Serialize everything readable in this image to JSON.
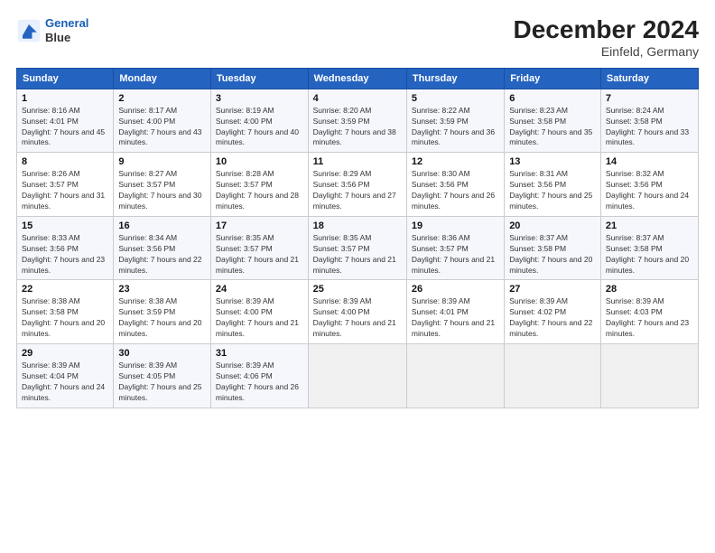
{
  "logo": {
    "line1": "General",
    "line2": "Blue"
  },
  "title": "December 2024",
  "subtitle": "Einfeld, Germany",
  "header_days": [
    "Sunday",
    "Monday",
    "Tuesday",
    "Wednesday",
    "Thursday",
    "Friday",
    "Saturday"
  ],
  "weeks": [
    [
      {
        "day": "1",
        "sunrise": "8:16 AM",
        "sunset": "4:01 PM",
        "daylight": "7 hours and 45 minutes."
      },
      {
        "day": "2",
        "sunrise": "8:17 AM",
        "sunset": "4:00 PM",
        "daylight": "7 hours and 43 minutes."
      },
      {
        "day": "3",
        "sunrise": "8:19 AM",
        "sunset": "4:00 PM",
        "daylight": "7 hours and 40 minutes."
      },
      {
        "day": "4",
        "sunrise": "8:20 AM",
        "sunset": "3:59 PM",
        "daylight": "7 hours and 38 minutes."
      },
      {
        "day": "5",
        "sunrise": "8:22 AM",
        "sunset": "3:59 PM",
        "daylight": "7 hours and 36 minutes."
      },
      {
        "day": "6",
        "sunrise": "8:23 AM",
        "sunset": "3:58 PM",
        "daylight": "7 hours and 35 minutes."
      },
      {
        "day": "7",
        "sunrise": "8:24 AM",
        "sunset": "3:58 PM",
        "daylight": "7 hours and 33 minutes."
      }
    ],
    [
      {
        "day": "8",
        "sunrise": "8:26 AM",
        "sunset": "3:57 PM",
        "daylight": "7 hours and 31 minutes."
      },
      {
        "day": "9",
        "sunrise": "8:27 AM",
        "sunset": "3:57 PM",
        "daylight": "7 hours and 30 minutes."
      },
      {
        "day": "10",
        "sunrise": "8:28 AM",
        "sunset": "3:57 PM",
        "daylight": "7 hours and 28 minutes."
      },
      {
        "day": "11",
        "sunrise": "8:29 AM",
        "sunset": "3:56 PM",
        "daylight": "7 hours and 27 minutes."
      },
      {
        "day": "12",
        "sunrise": "8:30 AM",
        "sunset": "3:56 PM",
        "daylight": "7 hours and 26 minutes."
      },
      {
        "day": "13",
        "sunrise": "8:31 AM",
        "sunset": "3:56 PM",
        "daylight": "7 hours and 25 minutes."
      },
      {
        "day": "14",
        "sunrise": "8:32 AM",
        "sunset": "3:56 PM",
        "daylight": "7 hours and 24 minutes."
      }
    ],
    [
      {
        "day": "15",
        "sunrise": "8:33 AM",
        "sunset": "3:56 PM",
        "daylight": "7 hours and 23 minutes."
      },
      {
        "day": "16",
        "sunrise": "8:34 AM",
        "sunset": "3:56 PM",
        "daylight": "7 hours and 22 minutes."
      },
      {
        "day": "17",
        "sunrise": "8:35 AM",
        "sunset": "3:57 PM",
        "daylight": "7 hours and 21 minutes."
      },
      {
        "day": "18",
        "sunrise": "8:35 AM",
        "sunset": "3:57 PM",
        "daylight": "7 hours and 21 minutes."
      },
      {
        "day": "19",
        "sunrise": "8:36 AM",
        "sunset": "3:57 PM",
        "daylight": "7 hours and 21 minutes."
      },
      {
        "day": "20",
        "sunrise": "8:37 AM",
        "sunset": "3:58 PM",
        "daylight": "7 hours and 20 minutes."
      },
      {
        "day": "21",
        "sunrise": "8:37 AM",
        "sunset": "3:58 PM",
        "daylight": "7 hours and 20 minutes."
      }
    ],
    [
      {
        "day": "22",
        "sunrise": "8:38 AM",
        "sunset": "3:58 PM",
        "daylight": "7 hours and 20 minutes."
      },
      {
        "day": "23",
        "sunrise": "8:38 AM",
        "sunset": "3:59 PM",
        "daylight": "7 hours and 20 minutes."
      },
      {
        "day": "24",
        "sunrise": "8:39 AM",
        "sunset": "4:00 PM",
        "daylight": "7 hours and 21 minutes."
      },
      {
        "day": "25",
        "sunrise": "8:39 AM",
        "sunset": "4:00 PM",
        "daylight": "7 hours and 21 minutes."
      },
      {
        "day": "26",
        "sunrise": "8:39 AM",
        "sunset": "4:01 PM",
        "daylight": "7 hours and 21 minutes."
      },
      {
        "day": "27",
        "sunrise": "8:39 AM",
        "sunset": "4:02 PM",
        "daylight": "7 hours and 22 minutes."
      },
      {
        "day": "28",
        "sunrise": "8:39 AM",
        "sunset": "4:03 PM",
        "daylight": "7 hours and 23 minutes."
      }
    ],
    [
      {
        "day": "29",
        "sunrise": "8:39 AM",
        "sunset": "4:04 PM",
        "daylight": "7 hours and 24 minutes."
      },
      {
        "day": "30",
        "sunrise": "8:39 AM",
        "sunset": "4:05 PM",
        "daylight": "7 hours and 25 minutes."
      },
      {
        "day": "31",
        "sunrise": "8:39 AM",
        "sunset": "4:06 PM",
        "daylight": "7 hours and 26 minutes."
      },
      null,
      null,
      null,
      null
    ]
  ]
}
